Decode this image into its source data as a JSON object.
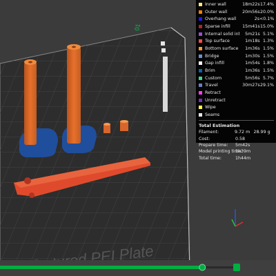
{
  "plate": {
    "label": "Textured PEI Plate",
    "corner_number": "01"
  },
  "features": [
    {
      "name": "Inner wall",
      "time": "18m22s",
      "percent": "17.4%",
      "color": "#ffe680"
    },
    {
      "name": "Outer wall",
      "time": "20m56s",
      "percent": "20.0%",
      "color": "#ff7f00"
    },
    {
      "name": "Overhang wall",
      "time": "2s",
      "percent": "<0.1%",
      "color": "#1a1aff"
    },
    {
      "name": "Sparse infill",
      "time": "15m41s",
      "percent": "15.0%",
      "color": "#b02525"
    },
    {
      "name": "Internal solid infill",
      "time": "5m21s",
      "percent": "5.1%",
      "color": "#9a4fcd"
    },
    {
      "name": "Top surface",
      "time": "1m18s",
      "percent": "1.3%",
      "color": "#ff4c4c"
    },
    {
      "name": "Bottom surface",
      "time": "1m36s",
      "percent": "1.5%",
      "color": "#ff9a3c"
    },
    {
      "name": "Bridge",
      "time": "1m30s",
      "percent": "1.5%",
      "color": "#6b8ed6"
    },
    {
      "name": "Gap infill",
      "time": "1m54s",
      "percent": "1.8%",
      "color": "#ffffff"
    },
    {
      "name": "Brim",
      "time": "1m36s",
      "percent": "1.5%",
      "color": "#0e5fb0"
    },
    {
      "name": "Custom",
      "time": "5m56s",
      "percent": "5.7%",
      "color": "#40d890"
    },
    {
      "name": "Travel",
      "time": "30m27s",
      "percent": "29.1%",
      "color": "#6b7fbf"
    },
    {
      "name": "Retract",
      "time": "",
      "percent": "",
      "color": "#ff3cff"
    },
    {
      "name": "Unretract",
      "time": "",
      "percent": "",
      "color": "#7a2fbf"
    },
    {
      "name": "Wipe",
      "time": "",
      "percent": "",
      "color": "#ffff4c"
    },
    {
      "name": "Seams",
      "time": "",
      "percent": "",
      "color": "#e6e6e6"
    }
  ],
  "estimation": {
    "title": "Total Estimation",
    "filament_label": "Filament:",
    "filament_length": "9.72 m",
    "filament_weight": "28.99 g",
    "cost_label": "Cost:",
    "cost": "0.58",
    "prepare_label": "Prepare time:",
    "prepare": "5m42s",
    "model_label": "Model printing time:",
    "model": "1h39m",
    "total_label": "Total time:",
    "total": "1h44m"
  },
  "layer_slider": {
    "fraction": 0.85
  },
  "colors": {
    "accent": "#00ae42",
    "model": "#e7702a",
    "brim": "#1f4e9c",
    "plate": "#2d2d2d"
  }
}
